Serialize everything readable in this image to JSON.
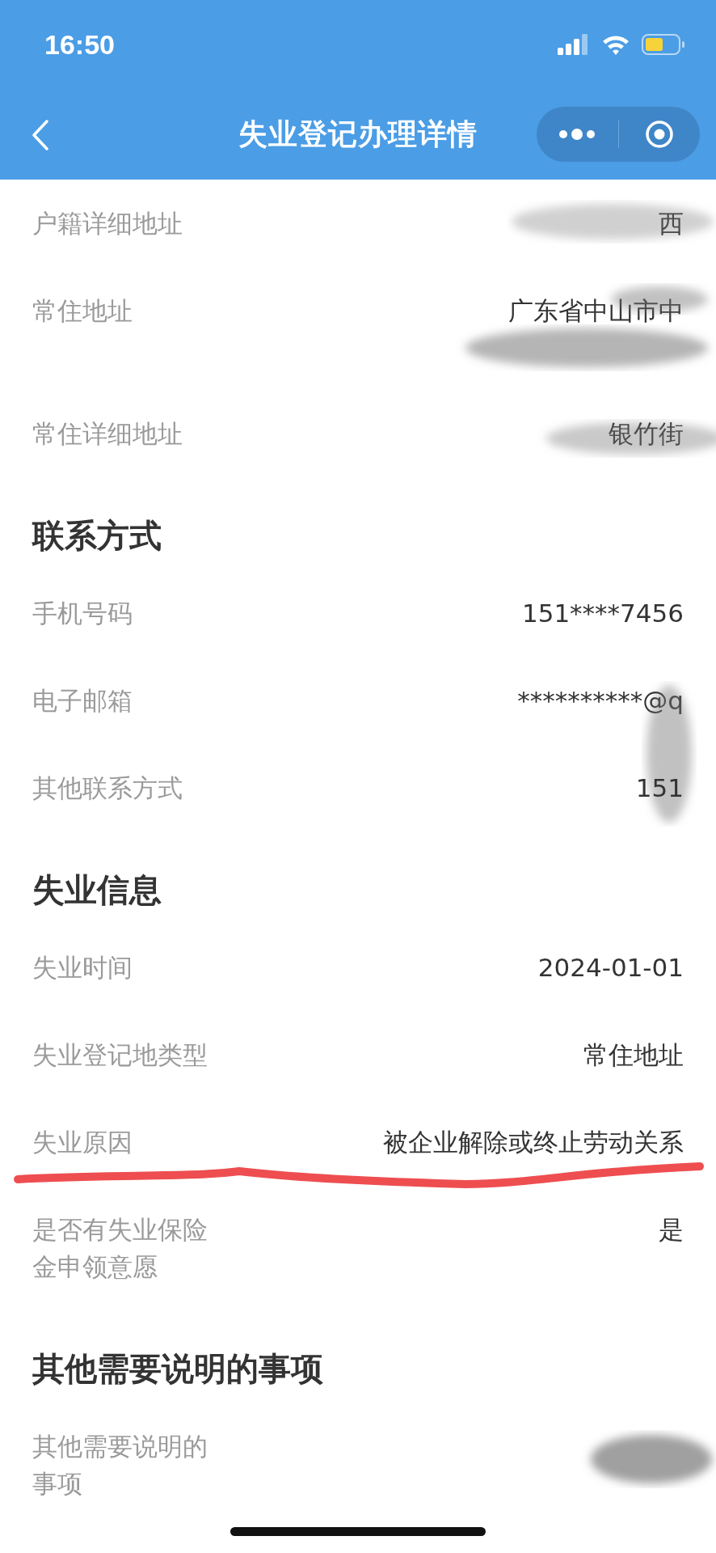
{
  "status_bar": {
    "time": "16:50"
  },
  "nav": {
    "title": "失业登记办理详情"
  },
  "sections": [
    {
      "rows": [
        {
          "label": "户籍详细地址",
          "value": "西",
          "redacted": true,
          "underlined": false
        },
        {
          "label": "常住地址",
          "value": "广东省中山市中",
          "redacted": true,
          "underlined": false
        },
        {
          "label": "常住详细地址",
          "value": "银竹街",
          "redacted": true,
          "underlined": false
        }
      ]
    },
    {
      "heading": "联系方式",
      "rows": [
        {
          "label": "手机号码",
          "value": "151****7456",
          "redacted": false,
          "underlined": false
        },
        {
          "label": "电子邮箱",
          "value": "**********@q",
          "redacted": true,
          "underlined": false
        },
        {
          "label": "其他联系方式",
          "value": "151",
          "redacted": false,
          "underlined": false
        }
      ]
    },
    {
      "heading": "失业信息",
      "rows": [
        {
          "label": "失业时间",
          "value": "2024-01-01",
          "redacted": false,
          "underlined": false
        },
        {
          "label": "失业登记地类型",
          "value": "常住地址",
          "redacted": false,
          "underlined": false
        },
        {
          "label": "失业原因",
          "value": "被企业解除或终止劳动关系",
          "redacted": false,
          "underlined": true
        },
        {
          "label": "是否有失业保险金申领意愿",
          "value": "是",
          "redacted": false,
          "underlined": false
        }
      ]
    },
    {
      "heading": "其他需要说明的事项",
      "rows": [
        {
          "label": "其他需要说明的事项",
          "value": "",
          "redacted": true,
          "underlined": false
        }
      ]
    }
  ]
}
